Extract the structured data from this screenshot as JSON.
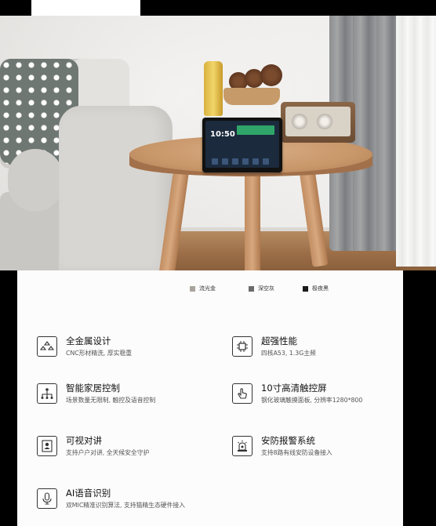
{
  "colors": {
    "options": [
      {
        "label": "流光金",
        "swatch": "#a9a59e"
      },
      {
        "label": "深空灰",
        "swatch": "#6b6b6b"
      },
      {
        "label": "极夜黑",
        "swatch": "#1a1a1a"
      }
    ]
  },
  "device_screen": {
    "clock": "10:50"
  },
  "features": [
    {
      "title": "全金属设计",
      "desc": "CNC形材精洗, 厚实稳重",
      "icon": "metal-body-icon"
    },
    {
      "title": "超强性能",
      "desc": "四核A53, 1.3G主频",
      "icon": "cpu-chip-icon"
    },
    {
      "title": "智能家居控制",
      "desc": "场景数量无限制, 触控及语音控制",
      "icon": "network-tree-icon"
    },
    {
      "title": "10寸高清触控屏",
      "desc": "钢化玻璃触摸面板, 分辨率1280*800",
      "icon": "touch-hand-icon"
    },
    {
      "title": "可视对讲",
      "desc": "支持户户对讲, 全天候安全守护",
      "icon": "intercom-contact-icon"
    },
    {
      "title": "安防报警系统",
      "desc": "支持8路有线安防设备接入",
      "icon": "alarm-light-icon"
    },
    {
      "title": "AI语音识别",
      "desc": "双MIC精准识别算法, 支持猫精生态硬件接入",
      "icon": "microphone-icon"
    }
  ]
}
